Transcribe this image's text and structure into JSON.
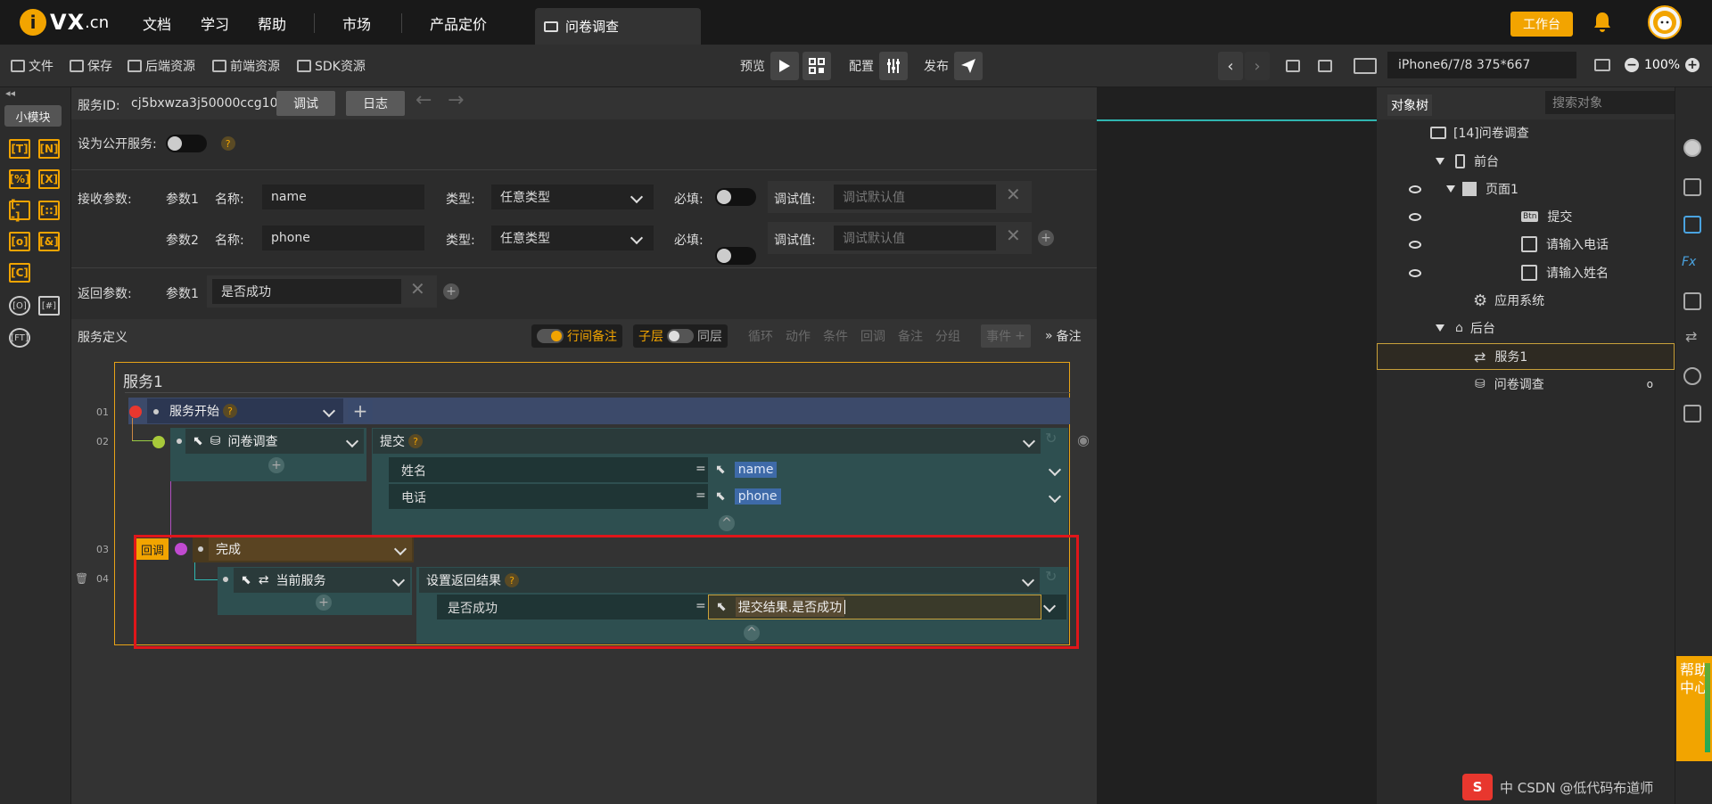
{
  "topbar": {
    "logo_text": "VX",
    "logo_suffix": ".cn",
    "nav": [
      "文档",
      "学习",
      "帮助",
      "市场",
      "产品定价"
    ],
    "doc_tab": "问卷调查",
    "workbench": "工作台"
  },
  "toolbar": {
    "file": "文件",
    "save": "保存",
    "backend": "后端资源",
    "frontend": "前端资源",
    "sdk": "SDK资源",
    "preview": "预览",
    "config": "配置",
    "publish": "发布",
    "device": "iPhone6/7/8 375*667",
    "zoom": "100%"
  },
  "leftbar": {
    "small_module": "小模块",
    "items": [
      "[T]",
      "[N]",
      "[%]",
      "[X]",
      "[--]",
      "[::]",
      "[o]",
      "[&]",
      "[C]",
      "[O]",
      "[#]",
      "[FT]"
    ]
  },
  "service": {
    "id_label": "服务ID:",
    "id_value": "cj5bxwza3j50000ccg10",
    "debug_btn": "调试",
    "log_btn": "日志",
    "public_label": "设为公开服务:",
    "receive_label": "接收参数:",
    "return_label": "返回参数:",
    "params": [
      {
        "label": "参数1",
        "name_label": "名称:",
        "name": "name",
        "type_label": "类型:",
        "type": "任意类型",
        "required_label": "必填:",
        "test_label": "调试值:",
        "test_placeholder": "调试默认值"
      },
      {
        "label": "参数2",
        "name_label": "名称:",
        "name": "phone",
        "type_label": "类型:",
        "type": "任意类型",
        "required_label": "必填:",
        "test_label": "调试值:",
        "test_placeholder": "调试默认值"
      }
    ],
    "return_params": [
      {
        "label": "参数1",
        "value": "是否成功"
      }
    ]
  },
  "definition": {
    "title": "服务定义",
    "line_note": "行间备注",
    "sub_layer": "子层",
    "same_layer": "同层",
    "actions": [
      "循环",
      "动作",
      "条件",
      "回调",
      "备注",
      "分组"
    ],
    "event": "事件",
    "note": "备注",
    "service_name": "服务1",
    "rows": [
      {
        "num": "01",
        "label": "服务开始"
      },
      {
        "num": "02",
        "target": "问卷调查",
        "action": "提交",
        "fields": [
          {
            "name": "姓名",
            "value": "name"
          },
          {
            "name": "电话",
            "value": "phone"
          }
        ]
      },
      {
        "num": "03",
        "callback": "回调",
        "label": "完成"
      },
      {
        "num": "04",
        "target": "当前服务",
        "action": "设置返回结果",
        "fields": [
          {
            "name": "是否成功",
            "value": "提交结果.是否成功"
          }
        ]
      }
    ],
    "eq": "="
  },
  "tree": {
    "tab": "对象树",
    "search_placeholder": "搜索对象",
    "items": [
      {
        "label": "[14]问卷调查"
      },
      {
        "label": "前台"
      },
      {
        "label": "页面1"
      },
      {
        "label": "提交",
        "badge": "Btn"
      },
      {
        "label": "请输入电话"
      },
      {
        "label": "请输入姓名"
      },
      {
        "label": "应用系统"
      },
      {
        "label": "后台"
      },
      {
        "label": "服务1"
      },
      {
        "label": "问卷调查",
        "suffix": "o"
      }
    ]
  },
  "help": "帮助中心",
  "watermark": "中 CSDN @低代码布道师",
  "colors": {
    "accent": "#f2a400",
    "highlight": "#e0161a",
    "teal": "#2fb5b0"
  }
}
